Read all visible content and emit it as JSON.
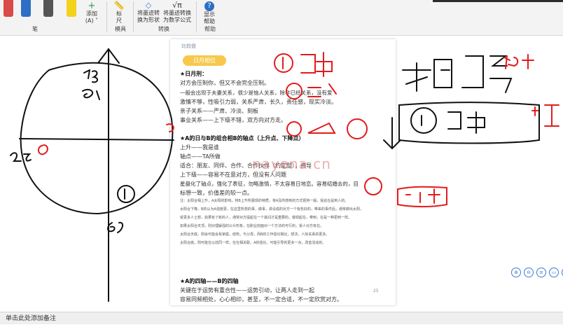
{
  "ribbon": {
    "groups": {
      "pen": "笔",
      "tools": "模具",
      "convert": "转换",
      "help": "帮助"
    },
    "buttons": {
      "add": "添加\n(A) ˅",
      "ruler": "标\n尺",
      "ink_to_shape": "将墨迹转\n换为形状",
      "ink_to_math": "将墨迹转换\n为数学公式",
      "help": "显示\n帮助"
    },
    "pen_colors": [
      "#d94a4a",
      "#2d6fc4",
      "#555555",
      "#f2d21b"
    ]
  },
  "doc": {
    "tag": "比较盘",
    "pill": "日月相位",
    "lines": [
      "★日月刑：",
      "对方会压制你，但又不会完全压制。",
      "一般会出现于夫妻关系，很少是恼人关系，除非已经关系，没有爱",
      "激情不够，性吸引力弱，关系严肃，长久，责任感，现实冷淡。",
      "亲子关系——严肃、冷淡、刻板",
      "事业关系——上下级不错，双方向对方走。",
      "★A的日与B的组合相B的轴点（上升点、下降点）",
      "上升——我是谁",
      "轴点——TA所做",
      "适合：朋友、同伴、合作、合作伙伴（约定型），资导",
      "上下级——容易不在意对方，但没有人问题",
      "星盘化了轴点，强化了表征，勿略激情，不太容易日地恋。容易结婚去的，目",
      "标想一致，价值差的较一点。"
    ],
    "small": [
      "注：太阳合相上升，A太阳的影响，将B上升所展现的特质，将A及所感到的方式把持一般，受此在是到人的。",
      "太阳合下降，B的认为A强度更，在这里所想的事，做事，讲设成的对方一个有些好的，带来的事件后，通常做出太阳，",
      "受更多人士想，如果有了新的人，通常对方提起在一个其间才是重要的，做现起在，带到，在是一种更到一样。",
      "如果太阳合天顶，则对理解强的公众形象，在职业前面对一个方法的可行的，受人对方有在。",
      "太阳合天底，则会可能会有家庭，结构，与父母，而B的工作强化相比，想法，人际关系的更多。",
      "太阳合底，则可能在以前同一样，在在相关联，A的强化，可能引导的更多一点，改善活动的。"
    ],
    "section2": "★A的四轴——B的四轴",
    "section2_lines": [
      "关键在于运势有重合性——运势引动，让两人走到一起",
      "容易同频相处，心心相印，甚至，不一定合适，不一定欣赏对方。"
    ],
    "page_num": "25"
  },
  "watermark": "nayona.cn",
  "status": {
    "text": "单击此处添加备注"
  },
  "float_tools": [
    "⊕",
    "⊖",
    "≡",
    "▭",
    "□",
    "⊡"
  ],
  "ink_colors": {
    "red": "#e31b1b",
    "black": "#111111",
    "blue": "#1a56c9"
  }
}
